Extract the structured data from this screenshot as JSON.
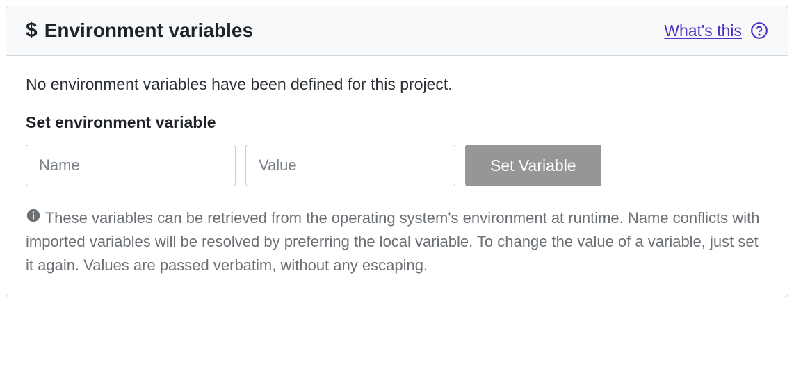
{
  "header": {
    "title": "Environment variables",
    "whats_this_label": "What's this"
  },
  "body": {
    "empty_message": "No environment variables have been defined for this project.",
    "form_heading": "Set environment variable",
    "name_placeholder": "Name",
    "value_placeholder": "Value",
    "button_label": "Set Variable",
    "help_text": "These variables can be retrieved from the operating system's environment at runtime. Name conflicts with imported variables will be resolved by preferring the local variable. To change the value of a variable, just set it again. Values are passed verbatim, without any escaping."
  },
  "colors": {
    "link": "#5034c4",
    "border": "#d7dadd",
    "header_bg": "#f8f9fb",
    "button_bg": "#969696",
    "muted_text": "#6b7075"
  }
}
